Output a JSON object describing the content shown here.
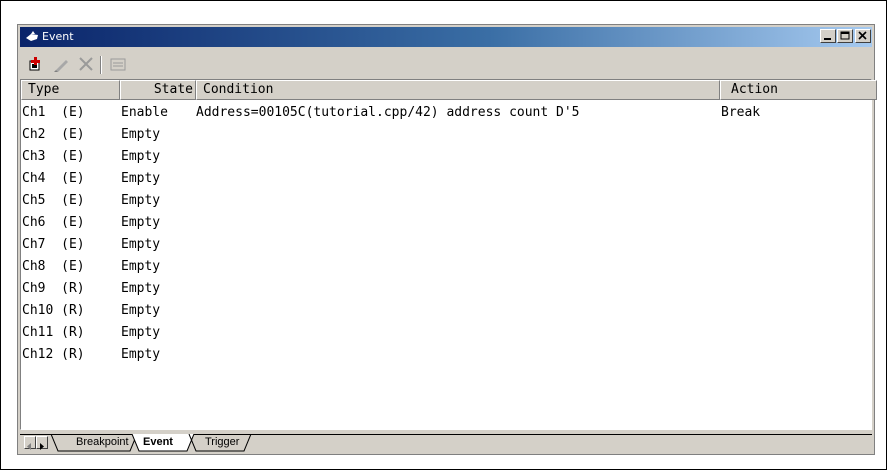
{
  "window": {
    "title": "Event"
  },
  "toolbar": {
    "buttons": [
      "add-event-icon",
      "edit-event-icon",
      "delete-event-icon",
      "properties-icon"
    ]
  },
  "columns": {
    "type": "Type",
    "state": "State",
    "condition": "Condition",
    "action": "Action"
  },
  "rows": [
    {
      "type": "Ch1  (E)",
      "state": "Enable",
      "condition": "Address=00105C(tutorial.cpp/42) address count D'5",
      "action": "Break"
    },
    {
      "type": "Ch2  (E)",
      "state": "Empty",
      "condition": "",
      "action": ""
    },
    {
      "type": "Ch3  (E)",
      "state": "Empty",
      "condition": "",
      "action": ""
    },
    {
      "type": "Ch4  (E)",
      "state": "Empty",
      "condition": "",
      "action": ""
    },
    {
      "type": "Ch5  (E)",
      "state": "Empty",
      "condition": "",
      "action": ""
    },
    {
      "type": "Ch6  (E)",
      "state": "Empty",
      "condition": "",
      "action": ""
    },
    {
      "type": "Ch7  (E)",
      "state": "Empty",
      "condition": "",
      "action": ""
    },
    {
      "type": "Ch8  (E)",
      "state": "Empty",
      "condition": "",
      "action": ""
    },
    {
      "type": "Ch9  (R)",
      "state": "Empty",
      "condition": "",
      "action": ""
    },
    {
      "type": "Ch10 (R)",
      "state": "Empty",
      "condition": "",
      "action": ""
    },
    {
      "type": "Ch11 (R)",
      "state": "Empty",
      "condition": "",
      "action": ""
    },
    {
      "type": "Ch12 (R)",
      "state": "Empty",
      "condition": "",
      "action": ""
    }
  ],
  "tabs": [
    {
      "label": "Breakpoint",
      "active": false
    },
    {
      "label": "Event",
      "active": true
    },
    {
      "label": "Trigger",
      "active": false
    }
  ],
  "colors": {
    "title_gradient_start": "#0a246a",
    "title_gradient_end": "#a6caf0",
    "face": "#d4d0c8"
  }
}
